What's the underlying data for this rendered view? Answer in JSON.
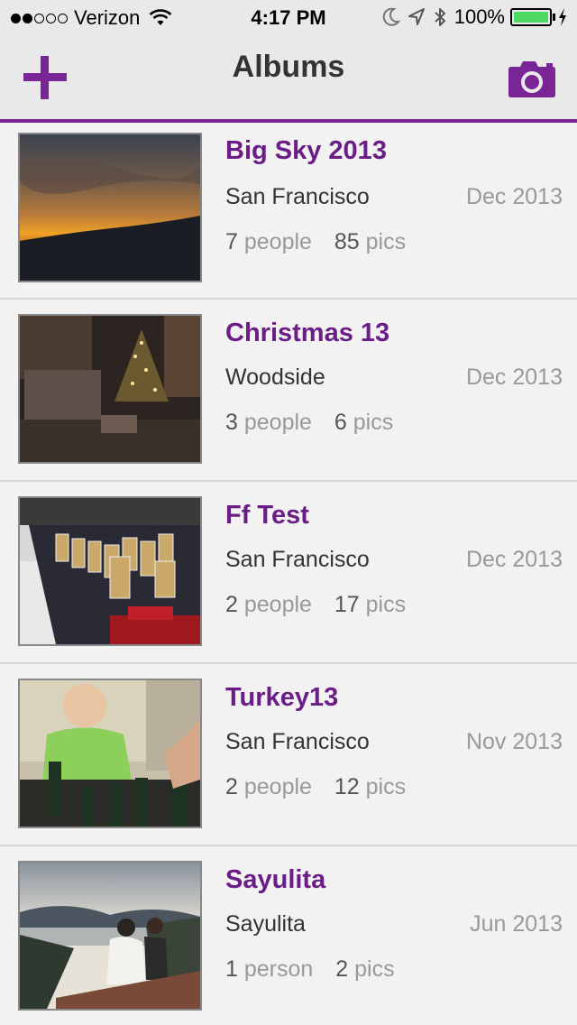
{
  "status_bar": {
    "carrier": "Verizon",
    "signal_dots_filled": 2,
    "signal_dots_total": 5,
    "time": "4:17 PM",
    "battery_percent": "100%",
    "icons": [
      "wifi-icon",
      "moon-icon",
      "location-arrow-icon",
      "bluetooth-icon",
      "battery-icon",
      "charging-bolt-icon"
    ]
  },
  "nav": {
    "title": "Albums",
    "left_icon": "plus-icon",
    "right_icon": "camera-icon"
  },
  "colors": {
    "accent": "#7a2596",
    "title": "#6b1d87",
    "nav_bg": "#e9e9e9",
    "list_bg": "#f2f2f2",
    "battery_green": "#4cd964"
  },
  "albums": [
    {
      "title": "Big Sky 2013",
      "location": "San Francisco",
      "date": "Dec 2013",
      "people_count": "7",
      "people_label": "people",
      "pics_count": "85",
      "pics_label": "pics",
      "thumbnail": "sunset-hill-photo"
    },
    {
      "title": "Christmas 13",
      "location": "Woodside",
      "date": "Dec 2013",
      "people_count": "3",
      "people_label": "people",
      "pics_count": "6",
      "pics_label": "pics",
      "thumbnail": "christmas-tree-photo"
    },
    {
      "title": "Ff Test",
      "location": "San Francisco",
      "date": "Dec 2013",
      "people_count": "2",
      "people_label": "people",
      "pics_count": "17",
      "pics_label": "pics",
      "thumbnail": "jars-table-photo"
    },
    {
      "title": "Turkey13",
      "location": "San Francisco",
      "date": "Nov 2013",
      "people_count": "2",
      "people_label": "people",
      "pics_count": "12",
      "pics_label": "pics",
      "thumbnail": "toddler-bottles-photo"
    },
    {
      "title": "Sayulita",
      "location": "Sayulita",
      "date": "Jun 2013",
      "people_count": "1",
      "people_label": "person",
      "pics_count": "2",
      "pics_label": "pics",
      "thumbnail": "coast-view-photo"
    }
  ]
}
